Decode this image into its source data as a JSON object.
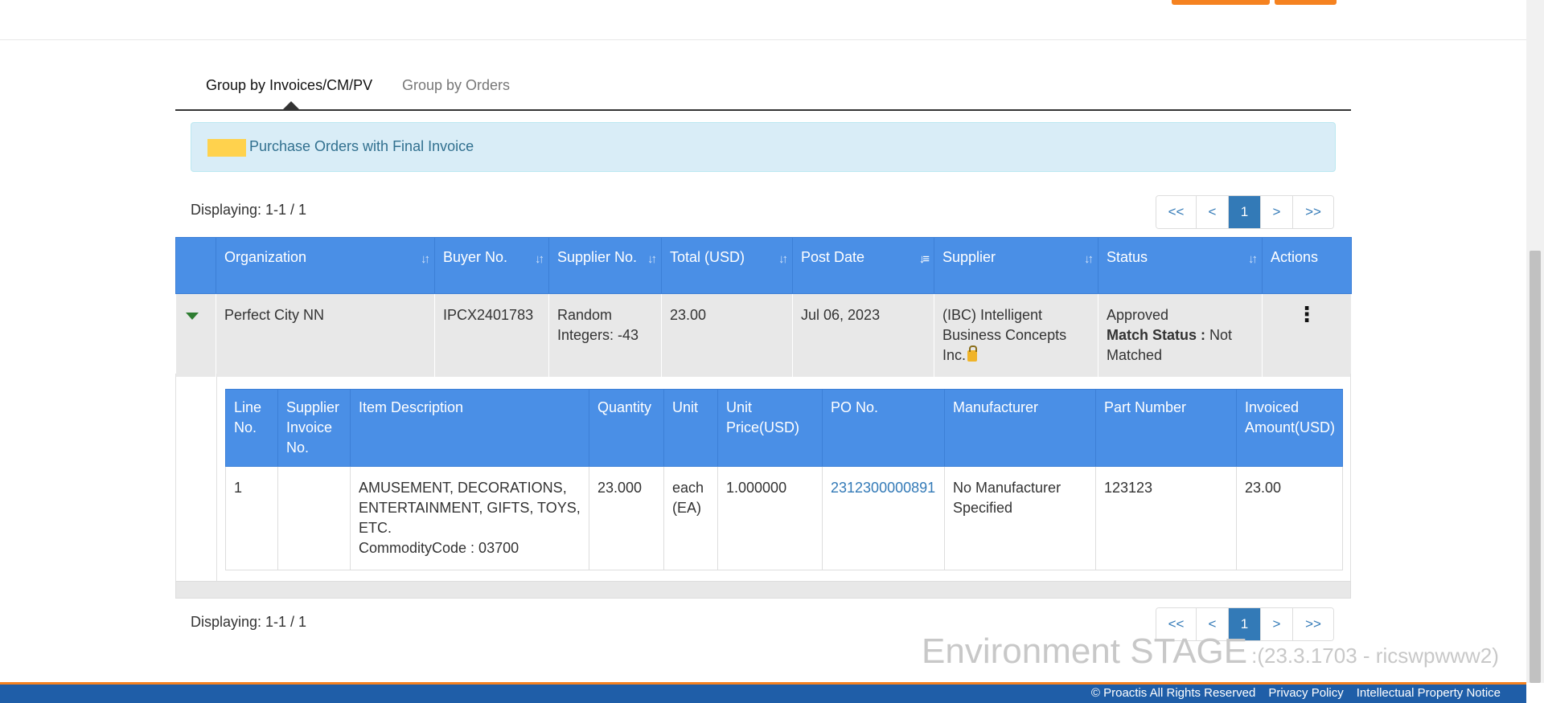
{
  "tabs": [
    {
      "label": "Group by Invoices/CM/PV"
    },
    {
      "label": "Group by Orders"
    }
  ],
  "legend": {
    "text": "Purchase Orders with Final Invoice",
    "swatch_color": "#ffd24d"
  },
  "displaying_top": "Displaying: 1-1 / 1",
  "displaying_bottom": "Displaying: 1-1 / 1",
  "pager": {
    "first": "<<",
    "prev": "<",
    "current": "1",
    "next": ">",
    "last": ">>"
  },
  "main_table": {
    "headers": {
      "organization": "Organization",
      "buyer_no": "Buyer No.",
      "supplier_no": "Supplier No.",
      "total": "Total (USD)",
      "post_date": "Post Date",
      "supplier": "Supplier",
      "status": "Status",
      "actions": "Actions"
    },
    "row": {
      "organization": "Perfect City NN",
      "buyer_no": "IPCX2401783",
      "supplier_no": "Random Integers: -43",
      "total": "23.00",
      "post_date": "Jul 06, 2023",
      "supplier": "(IBC) Intelligent Business Concepts Inc.",
      "status": "Approved",
      "match_label": "Match Status :",
      "match_value": "Not Matched"
    }
  },
  "line_table": {
    "headers": {
      "line_no": "Line No.",
      "supplier_invoice_no": "Supplier Invoice No.",
      "item_description": "Item Description",
      "quantity": "Quantity",
      "unit": "Unit",
      "unit_price": "Unit Price(USD)",
      "po_no": "PO No.",
      "manufacturer": "Manufacturer",
      "part_number": "Part Number",
      "invoiced_amount": "Invoiced Amount(USD)"
    },
    "row": {
      "line_no": "1",
      "supplier_invoice_no": "",
      "item_description": "AMUSEMENT, DECORATIONS, ENTERTAINMENT, GIFTS, TOYS, ETC.",
      "commodity_code": "CommodityCode : 03700",
      "quantity": "23.000",
      "unit": "each (EA)",
      "unit_price": "1.000000",
      "po_no": "2312300000891",
      "manufacturer": "No Manufacturer Specified",
      "part_number": "123123",
      "invoiced_amount": "23.00"
    }
  },
  "environment": {
    "label": "Environment STAGE",
    "version": ":(23.3.1703 - ricswpwww2)"
  },
  "footer": {
    "copyright": "© Proactis All Rights Reserved",
    "privacy": "Privacy Policy",
    "ip_notice": "Intellectual Property Notice"
  },
  "colors": {
    "header_blue": "#4a8fe6",
    "accent_orange": "#f58220",
    "footer_blue": "#1f5ea8"
  }
}
